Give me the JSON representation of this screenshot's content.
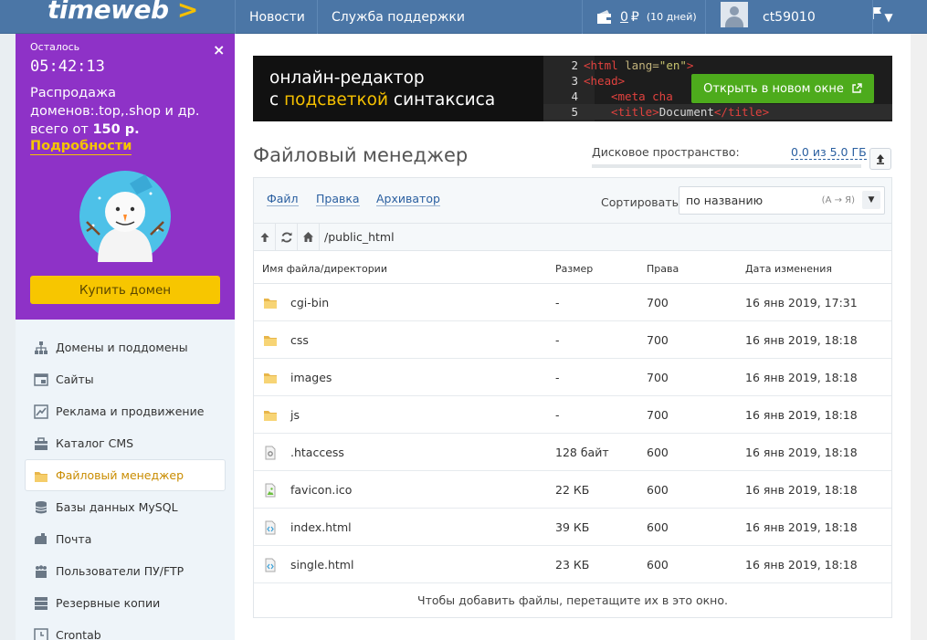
{
  "header": {
    "logo": "timeweb",
    "logo_arrow": ">",
    "nav": [
      {
        "label": "Новости"
      },
      {
        "label": "Служба поддержки"
      }
    ],
    "balance": {
      "amount": "0",
      "currency": "₽",
      "days": "(10 дней)"
    },
    "username": "ct59010"
  },
  "promo": {
    "remaining_label": "Осталось",
    "timer": "05:42:13",
    "text_line1": "Распродажа",
    "text_line2": "доменов:.top,.shop и др.",
    "text_line3_prefix": "всего от ",
    "text_line3_price": "150 р.",
    "more_link": "Подробности",
    "buy_button": "Купить домен",
    "close": "×"
  },
  "sidebar": {
    "items": [
      {
        "label": "Домены и поддомены",
        "icon": "sitemap-icon"
      },
      {
        "label": "Сайты",
        "icon": "browser-window-icon"
      },
      {
        "label": "Реклама и продвижение",
        "icon": "chart-icon"
      },
      {
        "label": "Каталог CMS",
        "icon": "toolbox-icon"
      },
      {
        "label": "Файловый менеджер",
        "icon": "folder-icon",
        "active": true
      },
      {
        "label": "Базы данных MySQL",
        "icon": "database-icon"
      },
      {
        "label": "Почта",
        "icon": "mailbox-icon"
      },
      {
        "label": "Пользователи ПУ/FTP",
        "icon": "users-icon"
      },
      {
        "label": "Резервные копии",
        "icon": "server-icon"
      },
      {
        "label": "Crontab",
        "icon": "clock-icon"
      }
    ]
  },
  "banner": {
    "title_line1": "онлайн-редактор",
    "title_line2_prefix": "с ",
    "title_line2_highlight": "подсветкой",
    "title_line2_suffix": " синтаксиса",
    "code_lines": [
      {
        "num": "2",
        "tag_open": "<html ",
        "attr": "lang=",
        "val": "\"en\"",
        "tag_close": ">"
      },
      {
        "num": "3",
        "tag_open": "<head>"
      },
      {
        "num": "4",
        "tag_open": "<meta cha"
      },
      {
        "num": "5",
        "tag_open": "<title>",
        "text": "Document",
        "tag_close": "</title>"
      }
    ],
    "open_button": "Открыть в новом окне"
  },
  "file_manager": {
    "title": "Файловый менеджер",
    "disk_label": "Дисковое пространство:",
    "disk_value": "0.0 из 5.0 ГБ",
    "disk_used_fraction": 0.0,
    "menu": [
      "Файл",
      "Правка",
      "Архиватор"
    ],
    "sort_label": "Сортировать:",
    "sort_value": "по названию",
    "sort_hint": "(А → Я)",
    "path": "/public_html",
    "columns": {
      "name": "Имя файла/директории",
      "size": "Размер",
      "perms": "Права",
      "modified": "Дата изменения"
    },
    "rows": [
      {
        "name": "cgi-bin",
        "size": "-",
        "perms": "700",
        "modified": "16 янв 2019, 17:31",
        "type": "folder"
      },
      {
        "name": "css",
        "size": "-",
        "perms": "700",
        "modified": "16 янв 2019, 18:18",
        "type": "folder"
      },
      {
        "name": "images",
        "size": "-",
        "perms": "700",
        "modified": "16 янв 2019, 18:18",
        "type": "folder"
      },
      {
        "name": "js",
        "size": "-",
        "perms": "700",
        "modified": "16 янв 2019, 18:18",
        "type": "folder"
      },
      {
        "name": ".htaccess",
        "size": "128 байт",
        "perms": "600",
        "modified": "16 янв 2019, 18:18",
        "type": "config"
      },
      {
        "name": "favicon.ico",
        "size": "22 КБ",
        "perms": "600",
        "modified": "16 янв 2019, 18:18",
        "type": "image"
      },
      {
        "name": "index.html",
        "size": "39 КБ",
        "perms": "600",
        "modified": "16 янв 2019, 18:18",
        "type": "html"
      },
      {
        "name": "single.html",
        "size": "23 КБ",
        "perms": "600",
        "modified": "16 янв 2019, 18:18",
        "type": "html"
      }
    ],
    "drop_hint": "Чтобы добавить файлы, перетащите их в это окно."
  },
  "colors": {
    "header": "#4b76a6",
    "promo": "#8e32c7",
    "accent_yellow": "#f7c600",
    "link": "#2a5fa0",
    "green_button": "#4dab1c"
  }
}
